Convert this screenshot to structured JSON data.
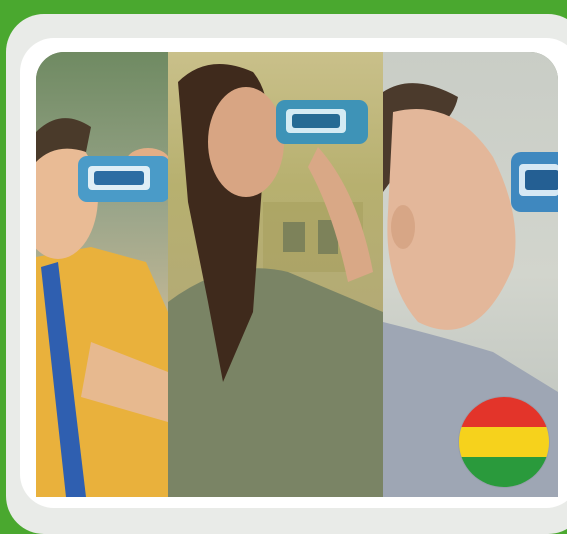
{
  "photo": {
    "panels": [
      {
        "name": "boy-drinking",
        "can_color": "#4a9bc8"
      },
      {
        "name": "woman-drinking",
        "can_color": "#3e93b7"
      },
      {
        "name": "man-drinking",
        "can_color": "#3f88bf"
      }
    ]
  },
  "flag": {
    "country": "Bolivia",
    "stripes": [
      "#e3342a",
      "#f6d21c",
      "#2a9a3c"
    ]
  },
  "colors": {
    "background": "#4aa82f",
    "outer_frame": "#e9ebe8",
    "inner_frame": "#ffffff"
  }
}
